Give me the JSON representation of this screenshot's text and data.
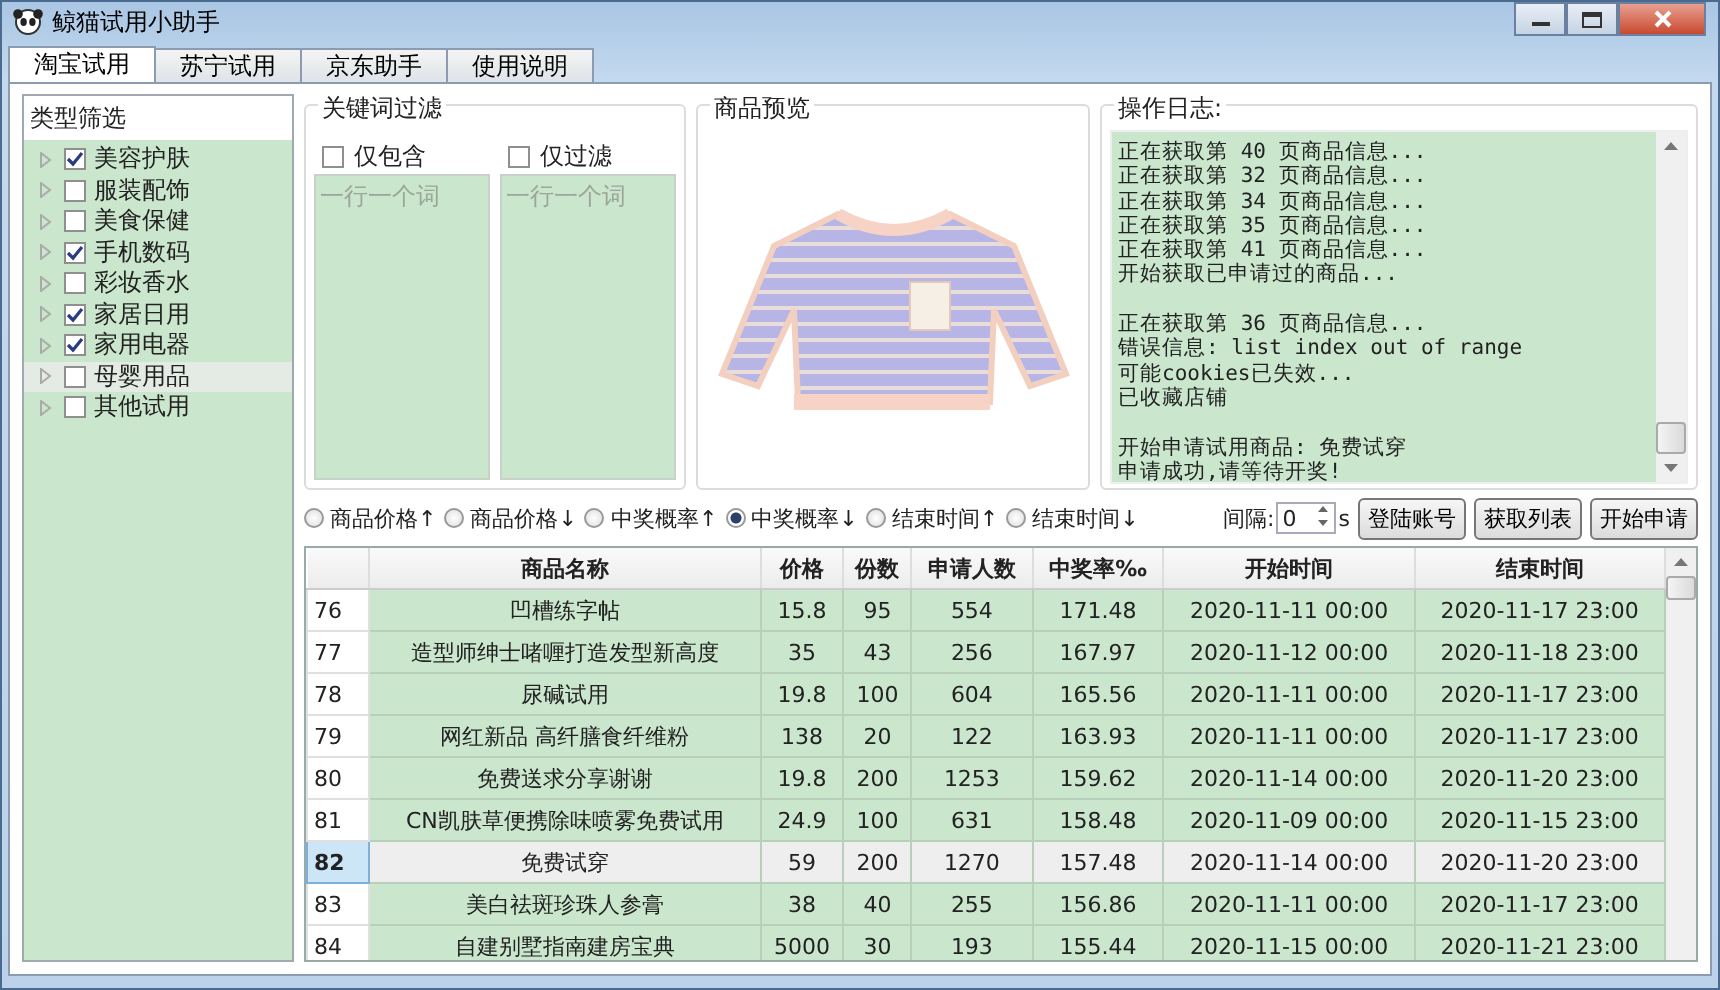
{
  "window": {
    "title": "鲸猫试用小助手"
  },
  "tabs": [
    {
      "label": "淘宝试用",
      "selected": true
    },
    {
      "label": "苏宁试用",
      "selected": false
    },
    {
      "label": "京东助手",
      "selected": false
    },
    {
      "label": "使用说明",
      "selected": false
    }
  ],
  "sidebar": {
    "title": "类型筛选",
    "items": [
      {
        "label": "美容护肤",
        "checked": true,
        "selected": false
      },
      {
        "label": "服装配饰",
        "checked": false,
        "selected": false
      },
      {
        "label": "美食保健",
        "checked": false,
        "selected": false
      },
      {
        "label": "手机数码",
        "checked": true,
        "selected": false
      },
      {
        "label": "彩妆香水",
        "checked": false,
        "selected": false
      },
      {
        "label": "家居日用",
        "checked": true,
        "selected": false
      },
      {
        "label": "家用电器",
        "checked": true,
        "selected": false
      },
      {
        "label": "母婴用品",
        "checked": false,
        "selected": true
      },
      {
        "label": "其他试用",
        "checked": false,
        "selected": false
      }
    ]
  },
  "keyword_filter": {
    "title": "关键词过滤",
    "fields": [
      {
        "label": "仅包含",
        "checked": false,
        "placeholder": "一行一个词"
      },
      {
        "label": "仅过滤",
        "checked": false,
        "placeholder": "一行一个词"
      }
    ]
  },
  "preview": {
    "title": "商品预览"
  },
  "log": {
    "title": "操作日志:",
    "paragraphs": [
      [
        "正在获取第 40 页商品信息...",
        "正在获取第 32 页商品信息...",
        "正在获取第 34 页商品信息...",
        "正在获取第 35 页商品信息...",
        "正在获取第 41 页商品信息...",
        "开始获取已申请过的商品..."
      ],
      [
        "正在获取第 36 页商品信息...",
        "错误信息: list index out of range",
        "可能cookies已失效...",
        "已收藏店铺"
      ],
      [
        "开始申请试用商品:  免费试穿",
        "申请成功,请等待开奖!"
      ]
    ]
  },
  "sort_options": [
    {
      "label": "商品价格↑",
      "selected": false
    },
    {
      "label": "商品价格↓",
      "selected": false
    },
    {
      "label": "中奖概率↑",
      "selected": false
    },
    {
      "label": "中奖概率↓",
      "selected": true
    },
    {
      "label": "结束时间↑",
      "selected": false
    },
    {
      "label": "结束时间↓",
      "selected": false
    }
  ],
  "interval": {
    "label": "间隔:",
    "value": "0",
    "unit": "s"
  },
  "buttons": [
    "登陆账号",
    "获取列表",
    "开始申请"
  ],
  "table": {
    "columns": [
      "商品名称",
      "价格",
      "份数",
      "申请人数",
      "中奖率‰",
      "开始时间",
      "结束时间"
    ],
    "rows": [
      {
        "number": "76",
        "selected": false,
        "cells": [
          "凹槽练字帖",
          "15.8",
          "95",
          "554",
          "171.48",
          "2020-11-11 00:00",
          "2020-11-17 23:00"
        ]
      },
      {
        "number": "77",
        "selected": false,
        "cells": [
          "造型师绅士啫喱打造发型新高度",
          "35",
          "43",
          "256",
          "167.97",
          "2020-11-12 00:00",
          "2020-11-18 23:00"
        ]
      },
      {
        "number": "78",
        "selected": false,
        "cells": [
          "尿碱试用",
          "19.8",
          "100",
          "604",
          "165.56",
          "2020-11-11 00:00",
          "2020-11-17 23:00"
        ]
      },
      {
        "number": "79",
        "selected": false,
        "cells": [
          "网红新品 高纤膳食纤维粉",
          "138",
          "20",
          "122",
          "163.93",
          "2020-11-11 00:00",
          "2020-11-17 23:00"
        ]
      },
      {
        "number": "80",
        "selected": false,
        "cells": [
          "免费送求分享谢谢",
          "19.8",
          "200",
          "1253",
          "159.62",
          "2020-11-14 00:00",
          "2020-11-20 23:00"
        ]
      },
      {
        "number": "81",
        "selected": false,
        "cells": [
          "CN凯肤草便携除味喷雾免费试用",
          "24.9",
          "100",
          "631",
          "158.48",
          "2020-11-09 00:00",
          "2020-11-15 23:00"
        ]
      },
      {
        "number": "82",
        "selected": true,
        "cells": [
          "免费试穿",
          "59",
          "200",
          "1270",
          "157.48",
          "2020-11-14 00:00",
          "2020-11-20 23:00"
        ]
      },
      {
        "number": "83",
        "selected": false,
        "cells": [
          "美白祛斑珍珠人参膏",
          "38",
          "40",
          "255",
          "156.86",
          "2020-11-11 00:00",
          "2020-11-17 23:00"
        ]
      },
      {
        "number": "84",
        "selected": false,
        "cells": [
          "自建别墅指南建房宝典",
          "5000",
          "30",
          "193",
          "155.44",
          "2020-11-15 00:00",
          "2020-11-21 23:00"
        ]
      }
    ]
  }
}
